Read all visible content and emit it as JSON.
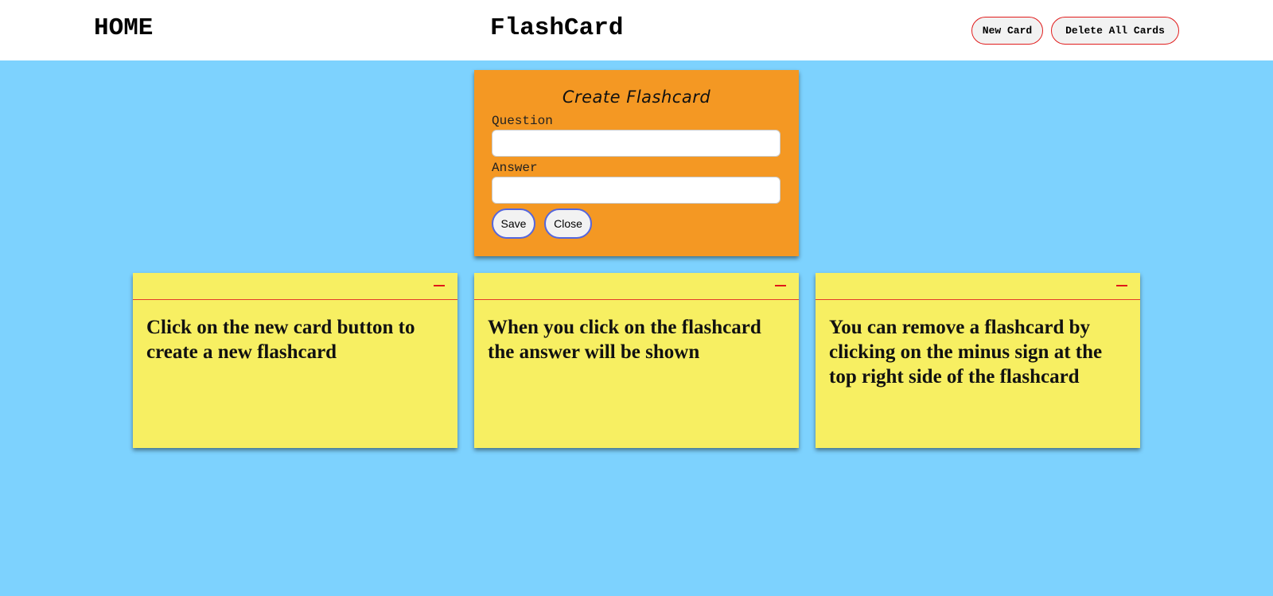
{
  "navbar": {
    "home_label": "HOME",
    "title": "FlashCard",
    "new_card_label": "New Card",
    "delete_all_label": "Delete All Cards"
  },
  "create_panel": {
    "title": "Create Flashcard",
    "question_label": "Question",
    "question_value": "",
    "answer_label": "Answer",
    "answer_value": "",
    "save_label": "Save",
    "close_label": "Close"
  },
  "cards": [
    {
      "text": "Click on the new card button to create a new flashcard"
    },
    {
      "text": "When you click on the flashcard the answer will be shown"
    },
    {
      "text": "You can remove a flashcard by clicking on the minus sign at the top right side of the flashcard"
    }
  ],
  "colors": {
    "background": "#7dd2fe",
    "navbar": "#ffffff",
    "panel": "#f49823",
    "card": "#f7ef62",
    "accent_red": "#e01818",
    "button_border_blue": "#5566dd"
  },
  "icons": {
    "card_remove": "minus-icon"
  }
}
